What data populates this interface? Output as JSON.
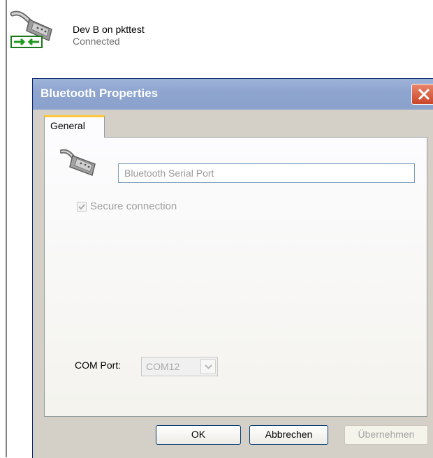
{
  "connection": {
    "name": "Dev B on pkttest",
    "status": "Connected"
  },
  "dialog": {
    "title": "Bluetooth Properties",
    "tabs": [
      {
        "label": "General"
      }
    ],
    "service_name_value": "Bluetooth Serial Port",
    "secure_connection": {
      "label": "Secure connection",
      "checked": true,
      "enabled": false
    },
    "com_port": {
      "label": "COM Port:",
      "value": "COM12",
      "enabled": false
    },
    "buttons": {
      "ok": "OK",
      "cancel": "Abbrechen",
      "apply": "Übernehmen"
    }
  },
  "colors": {
    "titlebar": "#8da4cf",
    "tab_highlight": "#ffc73c",
    "close_button": "#c9472b"
  },
  "icons": [
    "serial-connection-icon",
    "serial-port-icon",
    "close-icon",
    "checkmark-icon",
    "chevron-down-icon"
  ]
}
